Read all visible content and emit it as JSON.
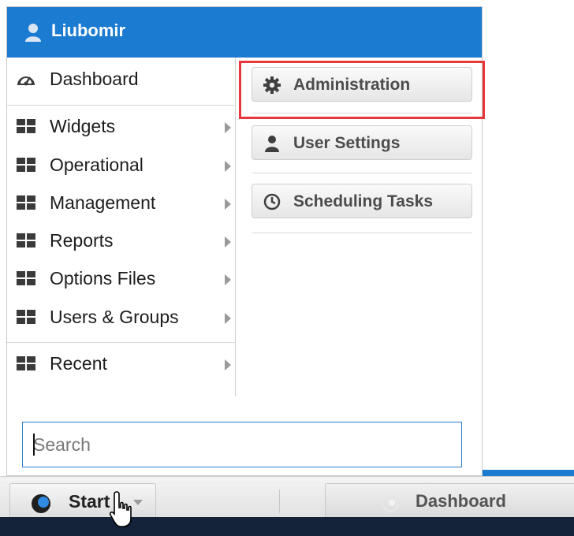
{
  "user": {
    "name": "Liubomir",
    "icon": "user-icon"
  },
  "nav": {
    "dashboard": {
      "label": "Dashboard",
      "icon": "dashboard-gauge-icon"
    },
    "items": [
      {
        "label": "Widgets",
        "icon": "grid-icon",
        "has_submenu": true
      },
      {
        "label": "Operational",
        "icon": "grid-icon",
        "has_submenu": true
      },
      {
        "label": "Management",
        "icon": "grid-icon",
        "has_submenu": true
      },
      {
        "label": "Reports",
        "icon": "grid-icon",
        "has_submenu": true
      },
      {
        "label": "Options Files",
        "icon": "grid-icon",
        "has_submenu": true
      },
      {
        "label": "Users & Groups",
        "icon": "grid-icon",
        "has_submenu": true
      }
    ],
    "recent": {
      "label": "Recent",
      "icon": "grid-icon",
      "has_submenu": true
    }
  },
  "right_panel": {
    "buttons": [
      {
        "label": "Administration",
        "icon": "gear-icon",
        "highlighted": true
      },
      {
        "label": "User Settings",
        "icon": "user-icon"
      },
      {
        "label": "Scheduling Tasks",
        "icon": "clock-icon"
      }
    ]
  },
  "search": {
    "placeholder": "Search",
    "value": ""
  },
  "taskbar": {
    "start_label": "Start",
    "dashboard_label": "Dashboard"
  },
  "colors": {
    "header_blue": "#1a7bd0",
    "highlight_red": "#e8383c",
    "search_border": "#2b7fd0",
    "bottom_bar": "#14233a"
  }
}
